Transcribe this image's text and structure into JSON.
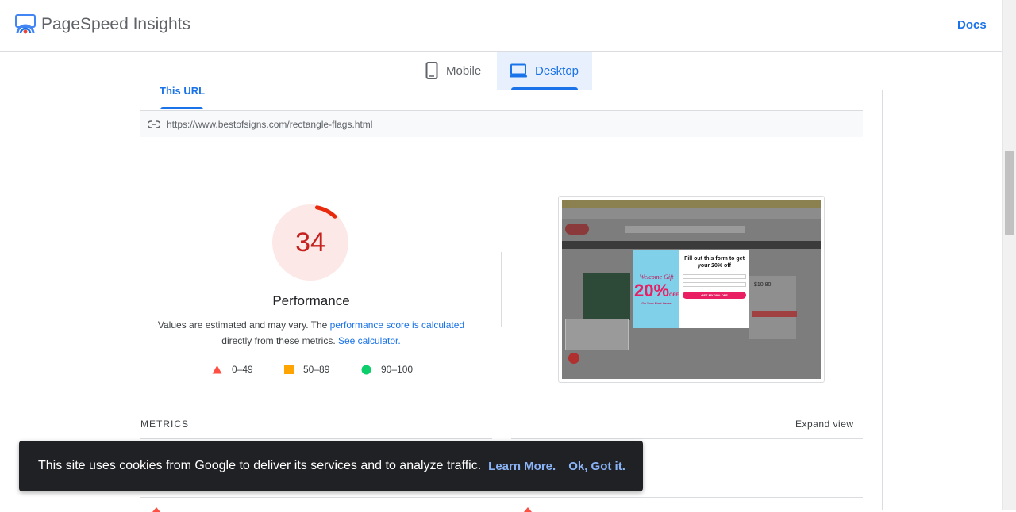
{
  "header": {
    "brand": "PageSpeed Insights",
    "docs_label": "Docs"
  },
  "device_tabs": {
    "mobile_label": "Mobile",
    "desktop_label": "Desktop",
    "selected": "Desktop"
  },
  "url_tab_label": "This URL",
  "url": "https://www.bestofsigns.com/rectangle-flags.html",
  "performance": {
    "score": "34",
    "score_fraction": 0.34,
    "title": "Performance",
    "desc_prefix": "Values are estimated and may vary. The ",
    "desc_link1": "performance score is calculated",
    "desc_middle": "directly from these metrics. ",
    "desc_link2": "See calculator.",
    "legend": [
      {
        "range": "0–49",
        "shape": "triangle",
        "color": "#ff4e42"
      },
      {
        "range": "50–89",
        "shape": "square",
        "color": "#ffa400"
      },
      {
        "range": "90–100",
        "shape": "circle",
        "color": "#0cce6b"
      }
    ],
    "colors": {
      "fail": "#c5221f",
      "fail_bg": "#fce8e6",
      "arc": "#e8290c"
    }
  },
  "screenshot": {
    "popup_heading": "Fill out this form to get your 20% off",
    "popup_welcome": "Welcome Gift",
    "popup_percent": "20%",
    "popup_off": "OFF",
    "popup_sub": "On Your First Order",
    "popup_btn": "GET MY 20% OFF",
    "price": "$10.80"
  },
  "metrics": {
    "label": "METRICS",
    "expand": "Expand view"
  },
  "cookie": {
    "text": "This site uses cookies from Google to deliver its services and to analyze traffic.",
    "learn_more": "Learn More.",
    "ok": "Ok, Got it."
  }
}
